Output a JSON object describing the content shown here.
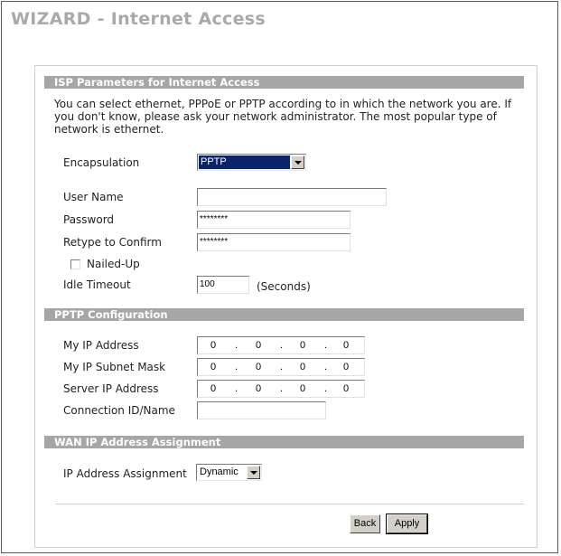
{
  "title": "WIZARD - Internet Access",
  "isp": {
    "header": "ISP Parameters for Internet Access",
    "description": "You can select ethernet, PPPoE or PPTP according to in which the network you are. If you don't know, please ask your network administrator. The most popular type of network is ethernet.",
    "encapsulation_label": "Encapsulation",
    "encapsulation_value": "PPTP",
    "username_label": "User Name",
    "username_value": "",
    "password_label": "Password",
    "password_value": "********",
    "retype_label": "Retype to Confirm",
    "retype_value": "********",
    "nailed_up_label": "Nailed-Up",
    "nailed_up_checked": false,
    "idle_timeout_label": "Idle Timeout",
    "idle_timeout_value": "100",
    "idle_timeout_unit": "(Seconds)"
  },
  "pptp": {
    "header": "PPTP Configuration",
    "my_ip_label": "My IP Address",
    "my_ip": [
      "0",
      "0",
      "0",
      "0"
    ],
    "subnet_label": "My IP Subnet Mask",
    "subnet": [
      "0",
      "0",
      "0",
      "0"
    ],
    "server_ip_label": "Server IP Address",
    "server_ip": [
      "0",
      "0",
      "0",
      "0"
    ],
    "conn_id_label": "Connection ID/Name",
    "conn_id_value": ""
  },
  "wan": {
    "header": "WAN IP Address Assignment",
    "assignment_label": "IP Address Assignment",
    "assignment_value": "Dynamic"
  },
  "buttons": {
    "back": "Back",
    "apply": "Apply"
  }
}
